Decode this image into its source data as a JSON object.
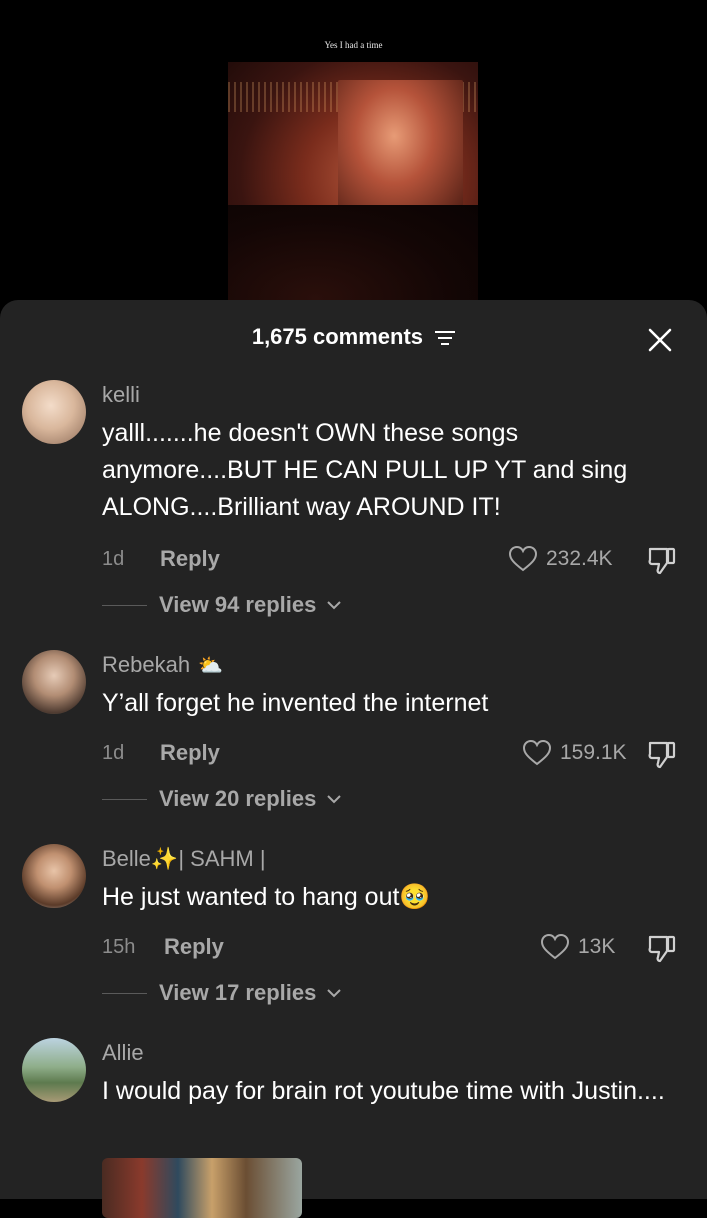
{
  "video": {
    "caption": "Yes I had a time"
  },
  "sheet": {
    "title": "1,675 comments"
  },
  "comments": [
    {
      "username": "kelli",
      "badge": "",
      "text": "yalll.......he doesn't OWN these songs anymore....BUT HE CAN PULL UP YT and sing ALONG....Brilliant way AROUND IT!",
      "time": "1d",
      "reply": "Reply",
      "likes": "232.4K",
      "view_replies": "View 94 replies"
    },
    {
      "username": "Rebekah",
      "badge": "⛅",
      "text": "Y’all forget he invented the internet",
      "time": "1d",
      "reply": "Reply",
      "likes": "159.1K",
      "view_replies": "View 20 replies"
    },
    {
      "username": "Belle✨| SAHM |",
      "badge": "",
      "text": "He just wanted to hang out🥹",
      "time": "15h",
      "reply": "Reply",
      "likes": "13K",
      "view_replies": "View 17 replies"
    },
    {
      "username": "Allie",
      "badge": "",
      "text": "I would pay for brain rot youtube time with Justin....",
      "time": "",
      "reply": "",
      "likes": "",
      "view_replies": ""
    }
  ],
  "icons": {
    "filter": "filter-icon",
    "close": "close-icon",
    "heart": "heart-icon",
    "dislike": "thumbs-down-icon",
    "chevron": "chevron-down-icon"
  }
}
